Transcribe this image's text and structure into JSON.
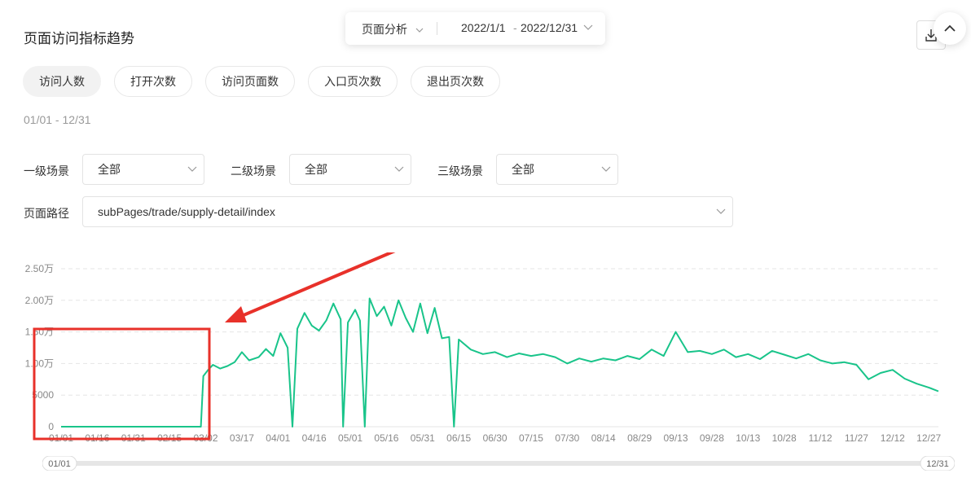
{
  "header": {
    "title": "页面访问指标趋势",
    "analysis_select": "页面分析",
    "date_start": "2022/1/1",
    "date_sep": "-",
    "date_end": "2022/12/31"
  },
  "tabs": [
    {
      "label": "访问人数",
      "active": true
    },
    {
      "label": "打开次数",
      "active": false
    },
    {
      "label": "访问页面数",
      "active": false
    },
    {
      "label": "入口页次数",
      "active": false
    },
    {
      "label": "退出页次数",
      "active": false
    }
  ],
  "date_range_text": "01/01 - 12/31",
  "filters": {
    "level1": {
      "label": "一级场景",
      "value": "全部"
    },
    "level2": {
      "label": "二级场景",
      "value": "全部"
    },
    "level3": {
      "label": "三级场景",
      "value": "全部"
    },
    "path": {
      "label": "页面路径",
      "value": "subPages/trade/supply-detail/index"
    }
  },
  "slider": {
    "start": "01/01",
    "end": "12/31"
  },
  "colors": {
    "line": "#19c48a",
    "annotation": "#e8312a",
    "grid": "#e5e5e5"
  },
  "chart_data": {
    "type": "line",
    "ylim": [
      0,
      25000
    ],
    "y_ticks": [
      {
        "value": 0,
        "label": "0"
      },
      {
        "value": 5000,
        "label": "5000"
      },
      {
        "value": 10000,
        "label": "1.00万"
      },
      {
        "value": 15000,
        "label": "1.50万"
      },
      {
        "value": 20000,
        "label": "2.00万"
      },
      {
        "value": 25000,
        "label": "2.50万"
      }
    ],
    "x_ticks": [
      "01/01",
      "01/16",
      "01/31",
      "02/15",
      "03/02",
      "03/17",
      "04/01",
      "04/16",
      "05/01",
      "05/16",
      "05/31",
      "06/15",
      "06/30",
      "07/15",
      "07/30",
      "08/14",
      "08/29",
      "09/13",
      "09/28",
      "10/13",
      "10/28",
      "11/12",
      "11/27",
      "12/12",
      "12/27"
    ],
    "grid": true,
    "series": [
      {
        "points": [
          [
            "01/01",
            0
          ],
          [
            "01/16",
            0
          ],
          [
            "01/31",
            0
          ],
          [
            "02/15",
            0
          ],
          [
            "02/28",
            0
          ],
          [
            "03/01",
            8000
          ],
          [
            "03/03",
            9000
          ],
          [
            "03/05",
            9800
          ],
          [
            "03/08",
            9200
          ],
          [
            "03/11",
            9600
          ],
          [
            "03/14",
            10200
          ],
          [
            "03/17",
            11800
          ],
          [
            "03/20",
            10500
          ],
          [
            "03/24",
            11000
          ],
          [
            "03/27",
            12300
          ],
          [
            "03/30",
            11200
          ],
          [
            "04/02",
            14800
          ],
          [
            "04/05",
            12500
          ],
          [
            "04/07",
            0
          ],
          [
            "04/09",
            15500
          ],
          [
            "04/12",
            18000
          ],
          [
            "04/15",
            16000
          ],
          [
            "04/18",
            15200
          ],
          [
            "04/21",
            16800
          ],
          [
            "04/24",
            19500
          ],
          [
            "04/27",
            17000
          ],
          [
            "04/28",
            0
          ],
          [
            "04/30",
            16500
          ],
          [
            "05/03",
            18500
          ],
          [
            "05/05",
            16800
          ],
          [
            "05/07",
            0
          ],
          [
            "05/09",
            20300
          ],
          [
            "05/12",
            17500
          ],
          [
            "05/15",
            19000
          ],
          [
            "05/18",
            16000
          ],
          [
            "05/21",
            20000
          ],
          [
            "05/24",
            17200
          ],
          [
            "05/27",
            15000
          ],
          [
            "05/30",
            19500
          ],
          [
            "06/02",
            14800
          ],
          [
            "06/05",
            18800
          ],
          [
            "06/08",
            14000
          ],
          [
            "06/11",
            14200
          ],
          [
            "06/13",
            0
          ],
          [
            "06/15",
            13800
          ],
          [
            "06/20",
            12200
          ],
          [
            "06/25",
            11500
          ],
          [
            "06/30",
            11800
          ],
          [
            "07/05",
            11000
          ],
          [
            "07/10",
            11600
          ],
          [
            "07/15",
            11200
          ],
          [
            "07/20",
            11500
          ],
          [
            "07/25",
            11000
          ],
          [
            "07/30",
            10000
          ],
          [
            "08/04",
            10800
          ],
          [
            "08/09",
            10300
          ],
          [
            "08/14",
            10800
          ],
          [
            "08/19",
            10500
          ],
          [
            "08/24",
            11200
          ],
          [
            "08/29",
            10700
          ],
          [
            "09/03",
            12200
          ],
          [
            "09/08",
            11200
          ],
          [
            "09/13",
            15000
          ],
          [
            "09/18",
            11800
          ],
          [
            "09/23",
            12000
          ],
          [
            "09/28",
            11500
          ],
          [
            "10/03",
            12200
          ],
          [
            "10/08",
            11000
          ],
          [
            "10/13",
            11500
          ],
          [
            "10/18",
            10700
          ],
          [
            "10/23",
            12000
          ],
          [
            "10/28",
            11400
          ],
          [
            "11/02",
            10800
          ],
          [
            "11/07",
            11500
          ],
          [
            "11/12",
            10500
          ],
          [
            "11/17",
            10000
          ],
          [
            "11/22",
            10200
          ],
          [
            "11/27",
            9800
          ],
          [
            "12/02",
            7500
          ],
          [
            "12/07",
            8500
          ],
          [
            "12/12",
            9000
          ],
          [
            "12/17",
            7600
          ],
          [
            "12/22",
            6800
          ],
          [
            "12/27",
            6200
          ],
          [
            "12/31",
            5600
          ]
        ]
      }
    ]
  }
}
